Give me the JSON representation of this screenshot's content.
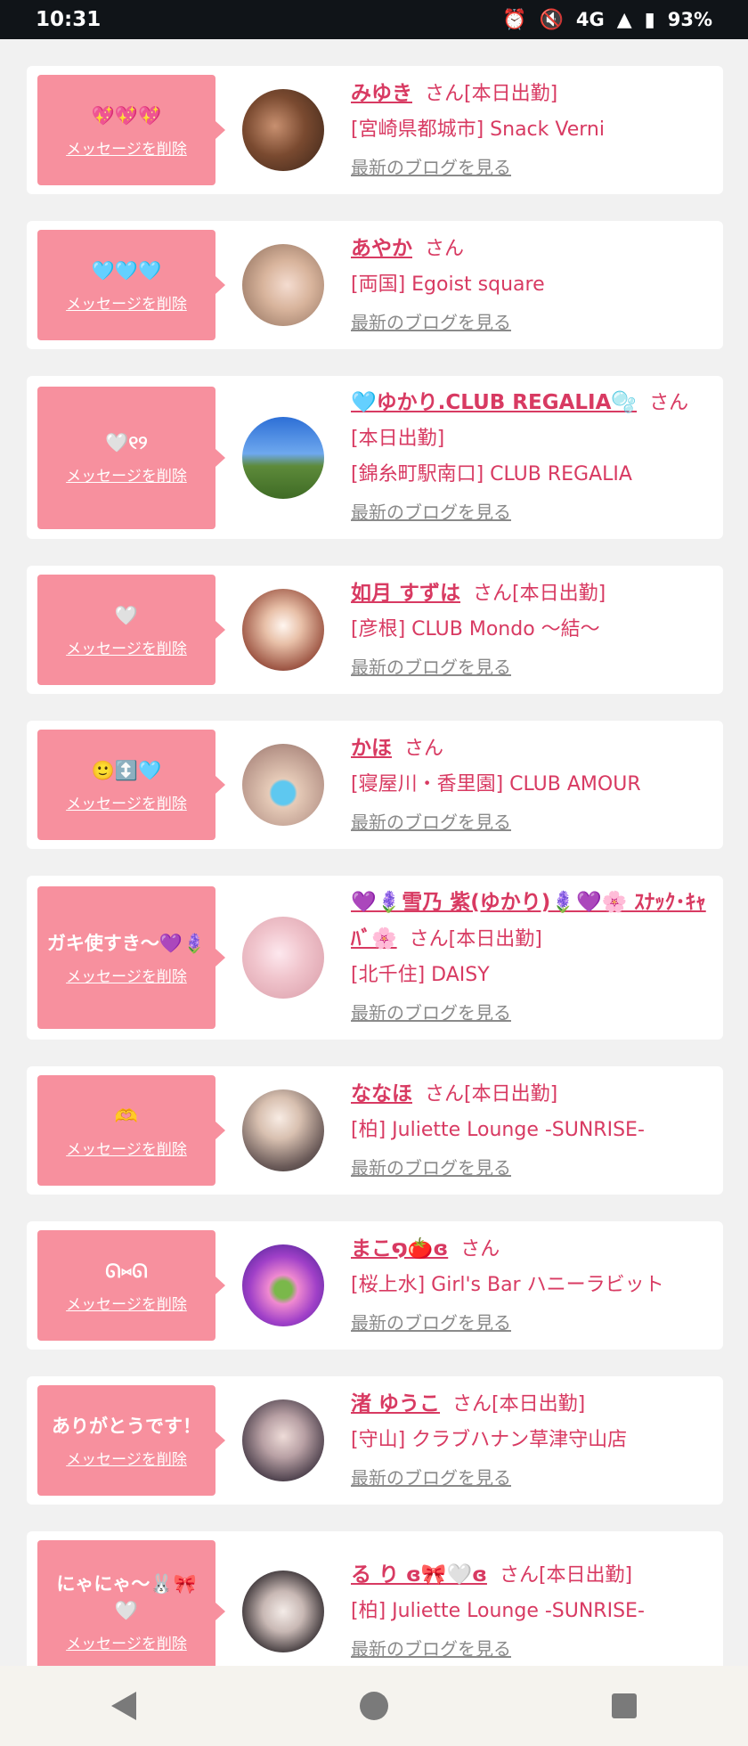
{
  "status": {
    "time": "10:31",
    "network": "4G",
    "battery": "93%"
  },
  "cards": [
    {
      "msg": "💖💖💖",
      "delete": "メッセージを削除",
      "name": "みゆき",
      "san": "さん[本日出勤]",
      "shop": "[宮崎県都城市] Snack Verni",
      "blog": "最新のブログを見る"
    },
    {
      "msg": "🩵🩵🩵",
      "delete": "メッセージを削除",
      "name": "あやか",
      "san": "さん",
      "shop": "[両国] Egoist square",
      "blog": "最新のブログを見る"
    },
    {
      "msg": "🤍୧୨",
      "delete": "メッセージを削除",
      "name": "🩵ゆかり.CLUB REGALIA🫧",
      "san": "さん[本日出勤]",
      "shop": "[錦糸町駅南口] CLUB REGALIA",
      "blog": "最新のブログを見る"
    },
    {
      "msg": "🤍",
      "delete": "メッセージを削除",
      "name": "如月 すずは",
      "san": "さん[本日出勤]",
      "shop": "[彦根] CLUB Mondo 〜結〜",
      "blog": "最新のブログを見る"
    },
    {
      "msg": "🙂↕️🩵",
      "delete": "メッセージを削除",
      "name": "かほ",
      "san": "さん",
      "shop": "[寝屋川・香里園] CLUB AMOUR",
      "blog": "最新のブログを見る"
    },
    {
      "msg": "ガキ使すき〜💜🪻",
      "delete": "メッセージを削除",
      "name": "💜🪻雪乃 紫(ゆかり)🪻💜🌸 ｽﾅｯｸ･ｷｬﾊﾞ🌸",
      "san": "さん[本日出勤]",
      "shop": "[北千住] DAISY",
      "blog": "最新のブログを見る"
    },
    {
      "msg": "🫶",
      "delete": "メッセージを削除",
      "name": "ななほ",
      "san": "さん[本日出勤]",
      "shop": "[柏] Juliette Lounge -SUNRISE-",
      "blog": "最新のブログを見る"
    },
    {
      "msg": "ᘏ⑅ᘏ",
      "delete": "メッセージを削除",
      "name": "まこ໑🍅ɞ",
      "san": "さん",
      "shop": "[桜上水] Girl's Bar ハニーラビット",
      "blog": "最新のブログを見る"
    },
    {
      "msg": "ありがとうです！",
      "delete": "メッセージを削除",
      "name": "渚 ゆうこ",
      "san": "さん[本日出勤]",
      "shop": "[守山] クラブハナン草津守山店",
      "blog": "最新のブログを見る"
    },
    {
      "msg": "にゃにゃ〜🐰🎀🤍",
      "delete": "メッセージを削除",
      "name": "る り ɞ🎀🤍ɞ",
      "san": "さん[本日出勤]",
      "shop": "[柏] Juliette Lounge -SUNRISE-",
      "blog": "最新のブログを見る"
    }
  ],
  "colors": {
    "accent": "#d83a62",
    "bubble": "#f7909e",
    "blog_link": "#8a8a8a"
  },
  "icons": [
    "alarm-icon",
    "mute-icon",
    "signal-icon",
    "battery-icon",
    "nav-back-icon",
    "nav-home-icon",
    "nav-recent-icon"
  ]
}
